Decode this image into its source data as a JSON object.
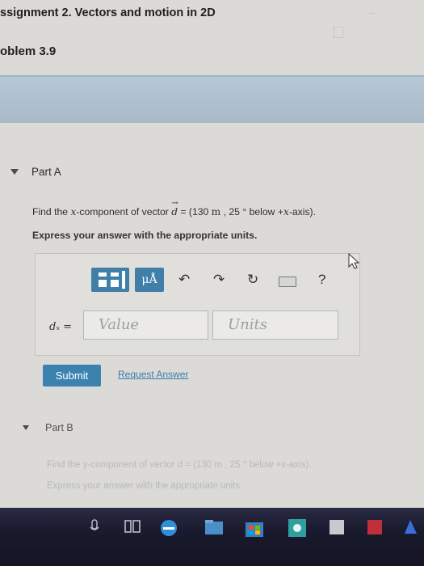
{
  "header": {
    "assignment_title": "ssignment 2. Vectors and motion in 2D",
    "problem": "oblem 3.9"
  },
  "part_a": {
    "label": "Part A",
    "question_prefix": "Find the ",
    "question_var": "x",
    "question_mid": "-component of vector ",
    "question_vec": "d",
    "question_eq": " = (130 ",
    "question_unit": "m",
    "question_rest": " , 25 ° below +",
    "question_axis": "x",
    "question_end": "-axis).",
    "instruction": "Express your answer with the appropriate units.",
    "toolbar": {
      "mu_label": "μÅ",
      "undo_glyph": "↶",
      "redo_glyph": "↷",
      "reset_glyph": "↻",
      "help_glyph": "?"
    },
    "answer_label": "dₓ =",
    "value_placeholder": "Value",
    "units_placeholder": "Units",
    "submit_label": "Submit",
    "request_label": "Request Answer"
  },
  "part_b": {
    "label": "Part B",
    "question": "Find the y-component of vector d = (130  m , 25 ° below +x-axis).",
    "instruction": "Express your answer with the appropriate units."
  },
  "colors": {
    "accent_blue": "#3b82b0",
    "band_blue": "#aebfcd",
    "taskbar": "#1a1a2e"
  }
}
